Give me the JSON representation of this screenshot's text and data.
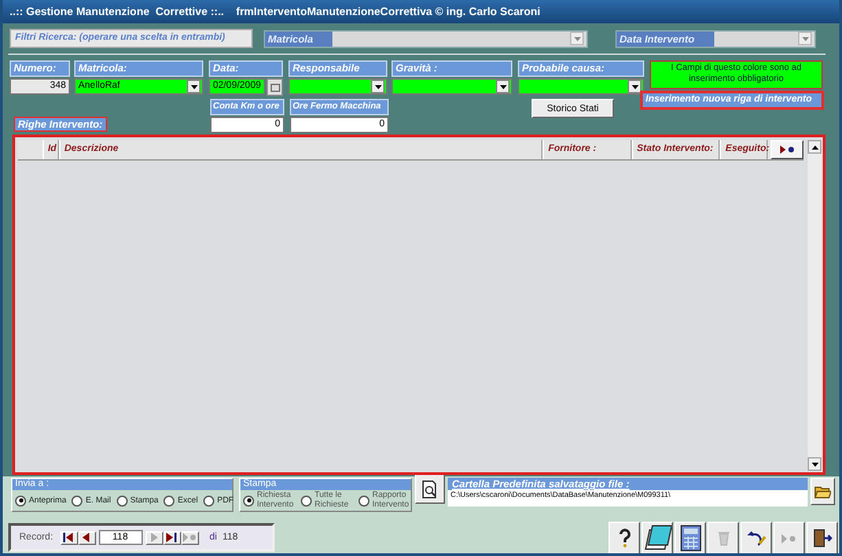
{
  "window": {
    "title": "..:: Gestione Manutenzione  Correttive ::..    frmInterventoManutenzioneCorrettiva © ing. Carlo Scaroni"
  },
  "filters": {
    "label": "Filtri Ricerca: (operare una scelta in  entrambi)",
    "fields": [
      {
        "label": "Matricola",
        "disabled": true
      },
      {
        "label": "Data Intervento",
        "disabled": true
      }
    ]
  },
  "fields": [
    {
      "label": "Numero:",
      "value": "348",
      "kind": "text",
      "required": false
    },
    {
      "label": "Matricola:",
      "value": "AnelloRaf",
      "kind": "combo",
      "required": true
    },
    {
      "label": "Data:",
      "value": "02/09/2009",
      "kind": "date",
      "required": true
    },
    {
      "label": "Responsabile",
      "kind": "combo",
      "required": true
    },
    {
      "label": "Gravità :",
      "kind": "combo",
      "required": true
    },
    {
      "label": "Probabile causa:",
      "kind": "combo",
      "required": true
    }
  ],
  "required_note": "I Campi di questo colore sono ad inserimento obbligatorio",
  "extra_fields": [
    {
      "label": "Conta Km o ore",
      "value": "0"
    },
    {
      "label": "Ore Fermo Macchina",
      "value": "0"
    }
  ],
  "history_button": "Storico Stati",
  "section_label": "Righe Intervento:",
  "new_row_label": "Inserimento nuova riga di intervento",
  "table": {
    "columns": [
      "Id",
      "Descrizione",
      "Fornitore :",
      "Stato Intervento:",
      "Eseguito:"
    ]
  },
  "send_to": {
    "title": "Invia a :",
    "options": [
      {
        "label": "Anteprima",
        "selected": true
      },
      {
        "label": "E. Mail",
        "selected": false
      },
      {
        "label": "Stampa",
        "selected": false
      },
      {
        "label": "Excel",
        "selected": false
      },
      {
        "label": "PDF",
        "selected": false
      }
    ]
  },
  "print": {
    "title": "Stampa",
    "options": [
      {
        "label": "Richiesta Intervento",
        "selected": true
      },
      {
        "label": "Tutte le Richieste",
        "selected": false
      },
      {
        "label": "Rapporto Intervento",
        "selected": false
      }
    ]
  },
  "folder": {
    "title": "Cartella Predefinita salvataggio file :",
    "path": "C:\\Users\\cscaroni\\Documents\\DataBase\\Manutenzione\\M099311\\"
  },
  "record_nav": {
    "label": "Record:",
    "current": "118",
    "of_label": "di",
    "total": "118"
  },
  "toolbar": [
    {
      "kind": "help",
      "disabled": false
    },
    {
      "kind": "notebook",
      "disabled": false
    },
    {
      "kind": "calculator",
      "disabled": false
    },
    {
      "kind": "trash",
      "disabled": true
    },
    {
      "kind": "undo",
      "disabled": false
    },
    {
      "kind": "new-record",
      "disabled": true
    },
    {
      "kind": "exit",
      "disabled": false
    }
  ]
}
